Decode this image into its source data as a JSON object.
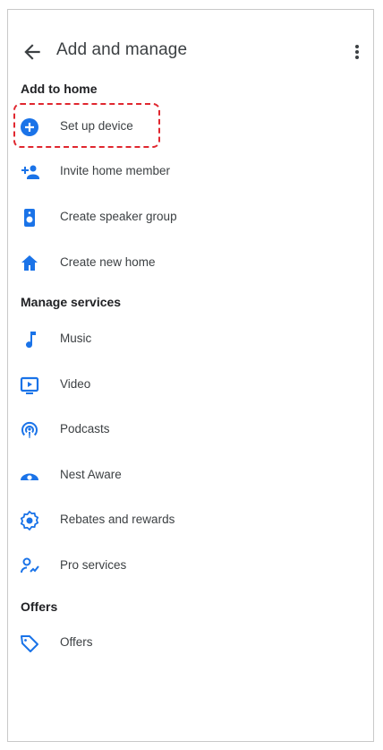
{
  "header": {
    "title": "Add and manage",
    "back_icon": "arrow-back-icon",
    "menu_icon": "more-vertical-icon"
  },
  "sections": [
    {
      "title": "Add to home",
      "items": [
        {
          "label": "Set up device",
          "icon": "add-circle-icon"
        },
        {
          "label": "Invite home member",
          "icon": "person-add-icon"
        },
        {
          "label": "Create speaker group",
          "icon": "speaker-icon"
        },
        {
          "label": "Create new home",
          "icon": "home-icon"
        }
      ]
    },
    {
      "title": "Manage services",
      "items": [
        {
          "label": "Music",
          "icon": "music-note-icon"
        },
        {
          "label": "Video",
          "icon": "video-icon"
        },
        {
          "label": "Podcasts",
          "icon": "podcasts-icon"
        },
        {
          "label": "Nest Aware",
          "icon": "nest-aware-icon"
        },
        {
          "label": "Rebates and rewards",
          "icon": "rebates-icon"
        },
        {
          "label": "Pro services",
          "icon": "pro-services-icon"
        }
      ]
    },
    {
      "title": "Offers",
      "items": [
        {
          "label": "Offers",
          "icon": "tag-icon"
        }
      ]
    }
  ],
  "colors": {
    "accent": "#1a73e8",
    "highlight": "#e0272f",
    "text": "#3c4043"
  }
}
